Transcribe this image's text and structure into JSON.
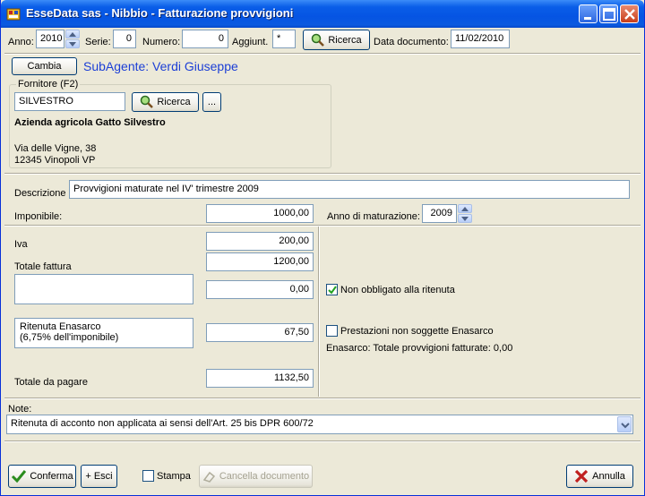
{
  "window": {
    "title": "EsseData sas - Nibbio - Fatturazione provvigioni"
  },
  "toolbar": {
    "anno_label": "Anno:",
    "anno_value": "2010",
    "serie_label": "Serie:",
    "serie_value": "0",
    "numero_label": "Numero:",
    "numero_value": "0",
    "aggiunt_label": "Aggiunt.",
    "aggiunt_value": "*",
    "ricerca_label": "Ricerca",
    "data_doc_label": "Data documento:",
    "data_doc_value": "11/02/2010"
  },
  "agent": {
    "cambia_label": "Cambia",
    "subagente_text": "SubAgente: Verdi Giuseppe"
  },
  "fornitore": {
    "group_label": "Fornitore (F2)",
    "search_value": "SILVESTRO",
    "ricerca_label": "Ricerca",
    "more_label": "...",
    "name": "Azienda agricola Gatto Silvestro",
    "address_line1": "Via delle Vigne, 38",
    "address_line2": "12345 Vinopoli VP"
  },
  "details": {
    "descrizione_label": "Descrizione",
    "descrizione_value": "Provvigioni maturate nel IV' trimestre 2009",
    "imponibile_label": "Imponibile:",
    "imponibile_value": "1000,00",
    "anno_maturazione_label": "Anno di maturazione:",
    "anno_maturazione_value": "2009"
  },
  "totals": {
    "iva_label": "Iva",
    "iva_value": "200,00",
    "totale_fattura_label": "Totale fattura",
    "totale_fattura_value": "1200,00",
    "ritenuta_value": "0,00",
    "enasarco_label_line1": "Ritenuta Enasarco",
    "enasarco_label_line2": "(6,75% dell'imponibile)",
    "enasarco_value": "67,50",
    "totale_pagare_label": "Totale da pagare",
    "totale_pagare_value": "1132,50"
  },
  "options": {
    "non_obbligato_label": "Non obbligato alla ritenuta",
    "non_obbligato_checked": true,
    "prestazioni_label": "Prestazioni non soggette Enasarco",
    "prestazioni_checked": false,
    "enasarco_totale_text": "Enasarco: Totale provvigioni fatturate: 0,00"
  },
  "note": {
    "label": "Note:",
    "value": "Ritenuta di acconto non applicata ai sensi dell'Art. 25 bis DPR 600/72"
  },
  "footer": {
    "conferma_label": "Conferma",
    "esci_label": "+ Esci",
    "stampa_label": "Stampa",
    "stampa_checked": false,
    "cancella_label": "Cancella documento",
    "annulla_label": "Annulla"
  },
  "colors": {
    "titlebar": "#0554e3",
    "window_bg": "#ece9d8",
    "subagente_text": "#1c3fd6",
    "confirm_check": "#2a8c1e",
    "cancel_x": "#c02020"
  }
}
